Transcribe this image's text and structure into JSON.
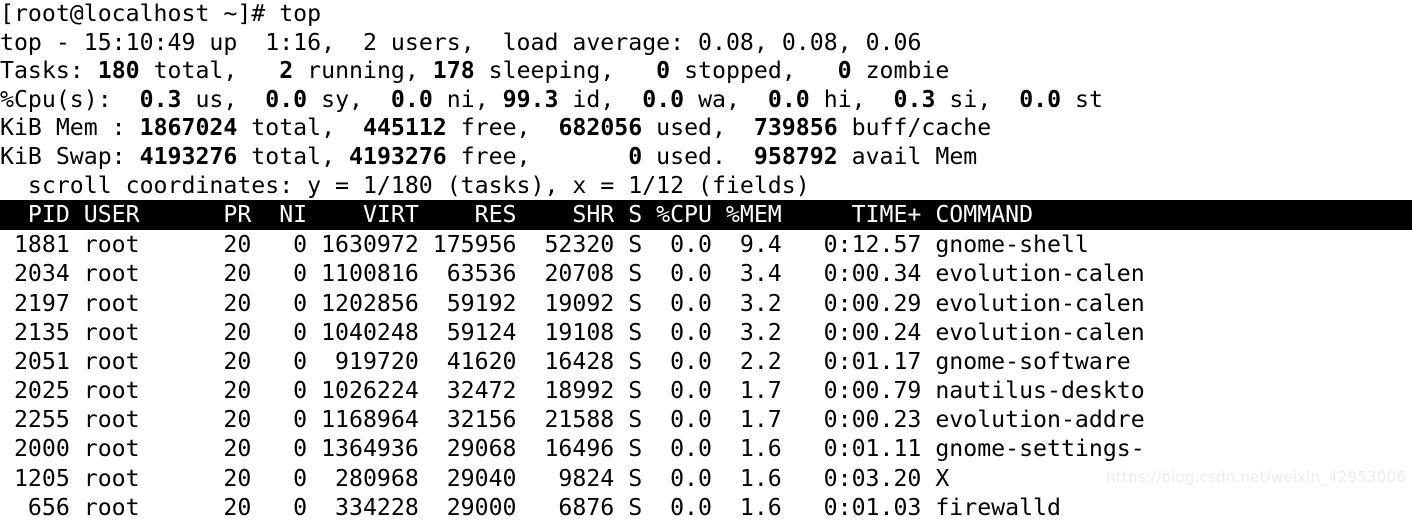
{
  "terminal": {
    "prompt_line": "[root@localhost ~]# top",
    "colors": {
      "background": "#ffffff",
      "foreground": "#000000",
      "header_background": "#000000",
      "header_foreground": "#ffffff",
      "watermark": "#ececec"
    }
  },
  "summary": {
    "uptime_line": {
      "program": "top - ",
      "time": "15:10:49",
      "up_label": " up ",
      "uptime": " 1:16,",
      "users": "  2 users,",
      "load_label": "  load average: ",
      "load_1": "0.08,",
      "load_5": " 0.08,",
      "load_15": " 0.06",
      "full": "top - 15:10:49 up  1:16,  2 users,  load average: 0.08, 0.08, 0.06"
    },
    "tasks_line": {
      "label": "Tasks: ",
      "total": "180",
      "total_label": " total,",
      "running": "   2",
      "running_label": " running,",
      "sleeping": " 178",
      "sleeping_label": " sleeping,",
      "stopped": "   0",
      "stopped_label": " stopped,",
      "zombie": "   0",
      "zombie_label": " zombie"
    },
    "cpu_line": {
      "label": "%Cpu(s):  ",
      "us": "0.3",
      "us_label": " us,  ",
      "sy": "0.0",
      "sy_label": " sy,  ",
      "ni": "0.0",
      "ni_label": " ni, ",
      "id": "99.3",
      "id_label": " id,  ",
      "wa": "0.0",
      "wa_label": " wa,  ",
      "hi": "0.0",
      "hi_label": " hi,  ",
      "si": "0.3",
      "si_label": " si,  ",
      "st": "0.0",
      "st_label": " st"
    },
    "mem_line": {
      "label": "KiB Mem : ",
      "total": "1867024",
      "total_label": " total,  ",
      "free": "445112",
      "free_label": " free,  ",
      "used": "682056",
      "used_label": " used,  ",
      "buffcache": "739856",
      "buffcache_label": " buff/cache"
    },
    "swap_line": {
      "label": "KiB Swap: ",
      "total": "4193276",
      "total_label": " total, ",
      "free": "4193276",
      "free_label": " free,       ",
      "used": "0",
      "used_label": " used.  ",
      "avail": "958792",
      "avail_label": " avail Mem"
    },
    "scroll_line": "  scroll coordinates: y = 1/180 (tasks), x = 1/12 (fields)"
  },
  "table": {
    "header": "  PID USER      PR  NI    VIRT    RES    SHR S %CPU %MEM     TIME+ COMMAND",
    "columns": [
      "PID",
      "USER",
      "PR",
      "NI",
      "VIRT",
      "RES",
      "SHR",
      "S",
      "%CPU",
      "%MEM",
      "TIME+",
      "COMMAND"
    ],
    "rows": [
      {
        "pid": "1881",
        "user": "root",
        "pr": "20",
        "ni": "0",
        "virt": "1630972",
        "res": "175956",
        "shr": "52320",
        "s": "S",
        "cpu": "0.0",
        "mem": "9.4",
        "time": "0:12.57",
        "command": "gnome-shell",
        "text": " 1881 root      20   0 1630972 175956  52320 S  0.0  9.4   0:12.57 gnome-shell"
      },
      {
        "pid": "2034",
        "user": "root",
        "pr": "20",
        "ni": "0",
        "virt": "1100816",
        "res": "63536",
        "shr": "20708",
        "s": "S",
        "cpu": "0.0",
        "mem": "3.4",
        "time": "0:00.34",
        "command": "evolution-calen",
        "text": " 2034 root      20   0 1100816  63536  20708 S  0.0  3.4   0:00.34 evolution-calen"
      },
      {
        "pid": "2197",
        "user": "root",
        "pr": "20",
        "ni": "0",
        "virt": "1202856",
        "res": "59192",
        "shr": "19092",
        "s": "S",
        "cpu": "0.0",
        "mem": "3.2",
        "time": "0:00.29",
        "command": "evolution-calen",
        "text": " 2197 root      20   0 1202856  59192  19092 S  0.0  3.2   0:00.29 evolution-calen"
      },
      {
        "pid": "2135",
        "user": "root",
        "pr": "20",
        "ni": "0",
        "virt": "1040248",
        "res": "59124",
        "shr": "19108",
        "s": "S",
        "cpu": "0.0",
        "mem": "3.2",
        "time": "0:00.24",
        "command": "evolution-calen",
        "text": " 2135 root      20   0 1040248  59124  19108 S  0.0  3.2   0:00.24 evolution-calen"
      },
      {
        "pid": "2051",
        "user": "root",
        "pr": "20",
        "ni": "0",
        "virt": "919720",
        "res": "41620",
        "shr": "16428",
        "s": "S",
        "cpu": "0.0",
        "mem": "2.2",
        "time": "0:01.17",
        "command": "gnome-software",
        "text": " 2051 root      20   0  919720  41620  16428 S  0.0  2.2   0:01.17 gnome-software"
      },
      {
        "pid": "2025",
        "user": "root",
        "pr": "20",
        "ni": "0",
        "virt": "1026224",
        "res": "32472",
        "shr": "18992",
        "s": "S",
        "cpu": "0.0",
        "mem": "1.7",
        "time": "0:00.79",
        "command": "nautilus-deskto",
        "text": " 2025 root      20   0 1026224  32472  18992 S  0.0  1.7   0:00.79 nautilus-deskto"
      },
      {
        "pid": "2255",
        "user": "root",
        "pr": "20",
        "ni": "0",
        "virt": "1168964",
        "res": "32156",
        "shr": "21588",
        "s": "S",
        "cpu": "0.0",
        "mem": "1.7",
        "time": "0:00.23",
        "command": "evolution-addre",
        "text": " 2255 root      20   0 1168964  32156  21588 S  0.0  1.7   0:00.23 evolution-addre"
      },
      {
        "pid": "2000",
        "user": "root",
        "pr": "20",
        "ni": "0",
        "virt": "1364936",
        "res": "29068",
        "shr": "16496",
        "s": "S",
        "cpu": "0.0",
        "mem": "1.6",
        "time": "0:01.11",
        "command": "gnome-settings-",
        "text": " 2000 root      20   0 1364936  29068  16496 S  0.0  1.6   0:01.11 gnome-settings-"
      },
      {
        "pid": "1205",
        "user": "root",
        "pr": "20",
        "ni": "0",
        "virt": "280968",
        "res": "29040",
        "shr": "9824",
        "s": "S",
        "cpu": "0.0",
        "mem": "1.6",
        "time": "0:03.20",
        "command": "X",
        "text": " 1205 root      20   0  280968  29040   9824 S  0.0  1.6   0:03.20 X"
      },
      {
        "pid": "656",
        "user": "root",
        "pr": "20",
        "ni": "0",
        "virt": "334228",
        "res": "29000",
        "shr": "6876",
        "s": "S",
        "cpu": "0.0",
        "mem": "1.6",
        "time": "0:01.03",
        "command": "firewalld",
        "text": "  656 root      20   0  334228  29000   6876 S  0.0  1.6   0:01.03 firewalld"
      }
    ]
  },
  "watermark": {
    "text": "https://blog.csdn.net/weixin_42953006"
  }
}
